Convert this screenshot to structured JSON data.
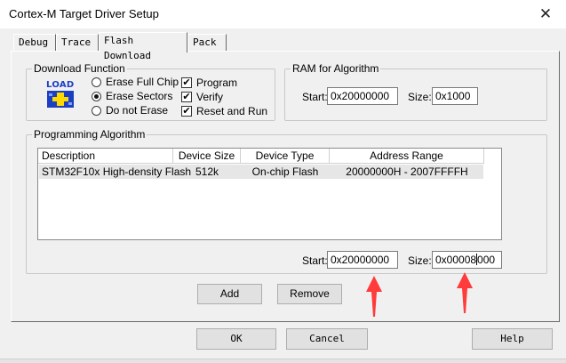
{
  "window": {
    "title": "Cortex-M Target Driver Setup",
    "close_symbol": "✕"
  },
  "tabs": [
    {
      "label": "Debug",
      "active": false
    },
    {
      "label": "Trace",
      "active": false
    },
    {
      "label": "Flash Download",
      "active": true
    },
    {
      "label": "Pack",
      "active": false
    }
  ],
  "download_function": {
    "label": "Download Function",
    "icon_text": "LOAD",
    "radios": [
      {
        "label": "Erase Full Chip",
        "selected": false
      },
      {
        "label": "Erase Sectors",
        "selected": true
      },
      {
        "label": "Do not Erase",
        "selected": false
      }
    ],
    "checkboxes": [
      {
        "label": "Program",
        "checked": true
      },
      {
        "label": "Verify",
        "checked": true
      },
      {
        "label": "Reset and Run",
        "checked": true
      }
    ],
    "check_glyph": "✔"
  },
  "ram_for_algorithm": {
    "label": "RAM for Algorithm",
    "start_label": "Start:",
    "start_value": "0x20000000",
    "size_label": "Size:",
    "size_value": "0x1000"
  },
  "programming_algorithm": {
    "label": "Programming Algorithm",
    "columns": [
      "Description",
      "Device Size",
      "Device Type",
      "Address Range"
    ],
    "rows": [
      {
        "description": "STM32F10x High-density Flash",
        "device_size": "512k",
        "device_type": "On-chip Flash",
        "address_range": "20000000H - 2007FFFFH"
      }
    ],
    "start_label": "Start:",
    "start_value": "0x20000000",
    "size_label": "Size:",
    "size_value_before_caret": "0x00008",
    "size_value_after_caret": "000",
    "add_label": "Add",
    "remove_label": "Remove"
  },
  "footer": {
    "ok_label": "OK",
    "cancel_label": "Cancel",
    "help_label": "Help"
  },
  "colors": {
    "annotation_arrow": "#ff3b3b",
    "icon_blue": "#1c3fc2",
    "icon_yellow": "#ffd800"
  }
}
